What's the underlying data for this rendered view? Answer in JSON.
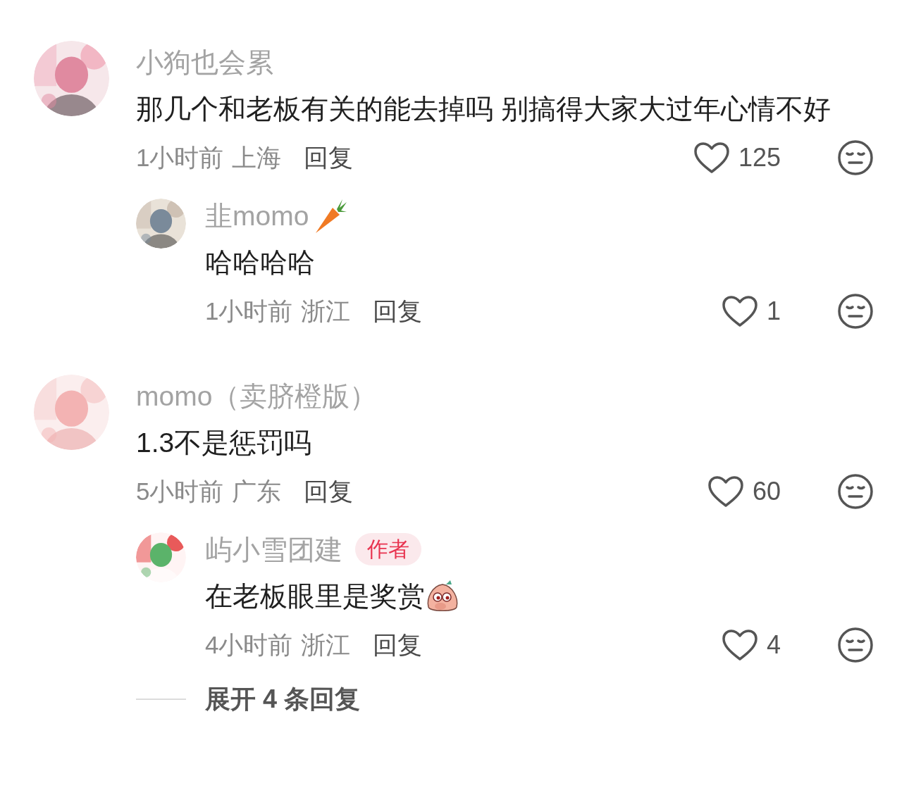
{
  "comments": [
    {
      "name": "小狗也会累",
      "text": "那几个和老板有关的能去掉吗 别搞得大家大过年心情不好",
      "time": "1小时前",
      "location": "上海",
      "reply_label": "回复",
      "likes": "125",
      "avatar": {
        "kind": "picture"
      },
      "replies": [
        {
          "name": "韭momo",
          "name_emoji": {
            "kind": "carrot"
          },
          "text": "哈哈哈哈",
          "time": "1小时前",
          "location": "浙江",
          "reply_label": "回复",
          "likes": "1",
          "avatar": {
            "kind": "picture"
          }
        }
      ]
    },
    {
      "name": "momo（卖脐橙版）",
      "text": "1.3不是惩罚吗",
      "time": "5小时前",
      "location": "广东",
      "reply_label": "回复",
      "likes": "60",
      "avatar": {
        "kind": "picture"
      },
      "replies": [
        {
          "name": "屿小雪团建",
          "badge": "作者",
          "text": "在老板眼里是奖赏",
          "text_emoji": {
            "kind": "peach"
          },
          "time": "4小时前",
          "location": "浙江",
          "reply_label": "回复",
          "likes": "4",
          "avatar": {
            "kind": "picture"
          }
        }
      ],
      "expand": "展开 4 条回复"
    }
  ]
}
